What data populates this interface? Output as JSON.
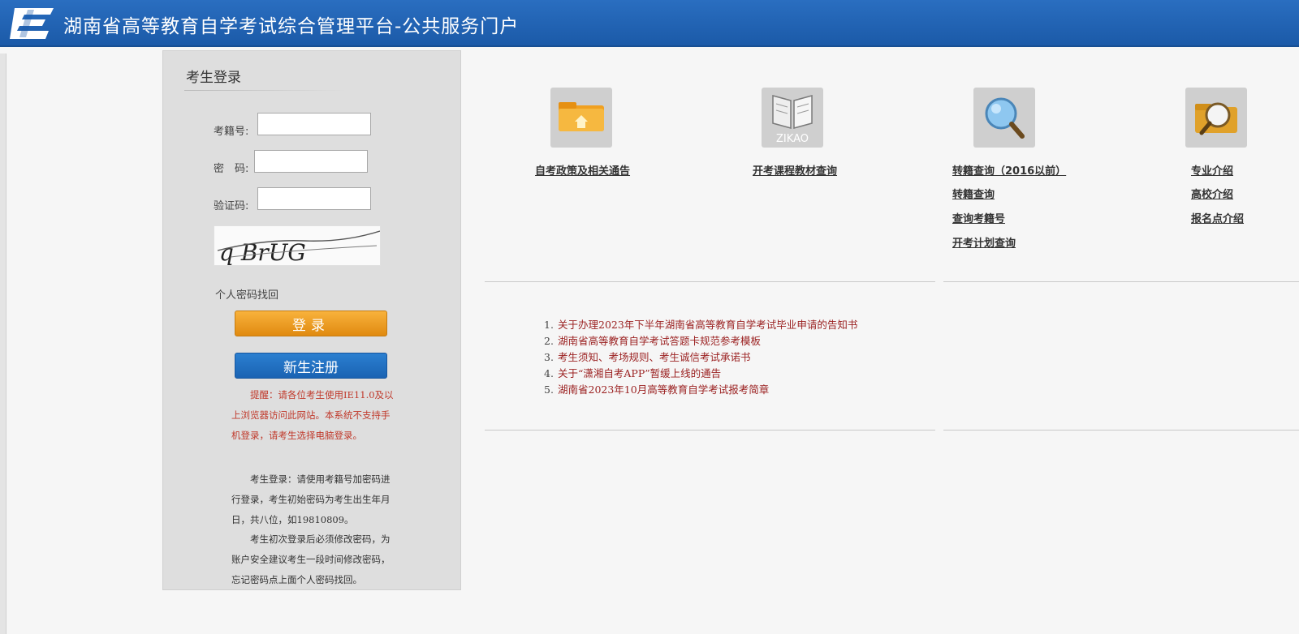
{
  "header": {
    "title": "湖南省高等教育自学考试综合管理平台-公共服务门户"
  },
  "login": {
    "title": "考生登录",
    "exam_id_label": "考籍号:",
    "password_label": "密　码:",
    "captcha_label": "验证码:",
    "exam_id_value": "",
    "password_value": "",
    "captcha_value": "",
    "captcha_text": "q BrUG",
    "recover_label": "个人密码找回",
    "login_button": "登录",
    "register_button": "新生注册",
    "notice_red": "　　提醒：请各位考生使用IE11.0及以上浏览器访问此网站。本系统不支持手机登录，请考生选择电脑登录。",
    "notice_login": "　　考生登录：请使用考籍号加密码进行登录，考生初始密码为考生出生年月日，共八位，如19810809。",
    "notice_first": "　　考生初次登录后必须修改密码，为账户安全建议考生一段时间修改密码，忘记密码点上面个人密码找回。"
  },
  "tiles": [
    {
      "icon": "folder-home-icon",
      "links": [
        "自考政策及相关通告"
      ]
    },
    {
      "icon": "zikao-book-icon",
      "links": [
        "开考课程教材查询"
      ]
    },
    {
      "icon": "magnifier-icon",
      "links": [
        "转籍查询（2016以前）",
        "转籍查询",
        "查询考籍号",
        "开考计划查询"
      ]
    },
    {
      "icon": "folder-search-icon",
      "links": [
        "专业介绍",
        "高校介绍",
        "报名点介绍"
      ]
    }
  ],
  "zikao_badge": "ZIKAO",
  "news": [
    {
      "num": "1.",
      "text": "关于办理2023年下半年湖南省高等教育自学考试毕业申请的告知书"
    },
    {
      "num": "2.",
      "text": "湖南省高等教育自学考试答题卡规范参考模板"
    },
    {
      "num": "3.",
      "text": "考生须知、考场规则、考生诚信考试承诺书"
    },
    {
      "num": "4.",
      "text": "关于“潇湘自考APP”暂缓上线的通告"
    },
    {
      "num": "5.",
      "text": "湖南省2023年10月高等教育自学考试报考简章"
    }
  ],
  "colors": {
    "header_blue": "#1b5aa8",
    "login_orange": "#e8941a",
    "register_blue": "#1f6fc3",
    "notice_red": "#c0392b",
    "news_red": "#9a1f1f"
  }
}
